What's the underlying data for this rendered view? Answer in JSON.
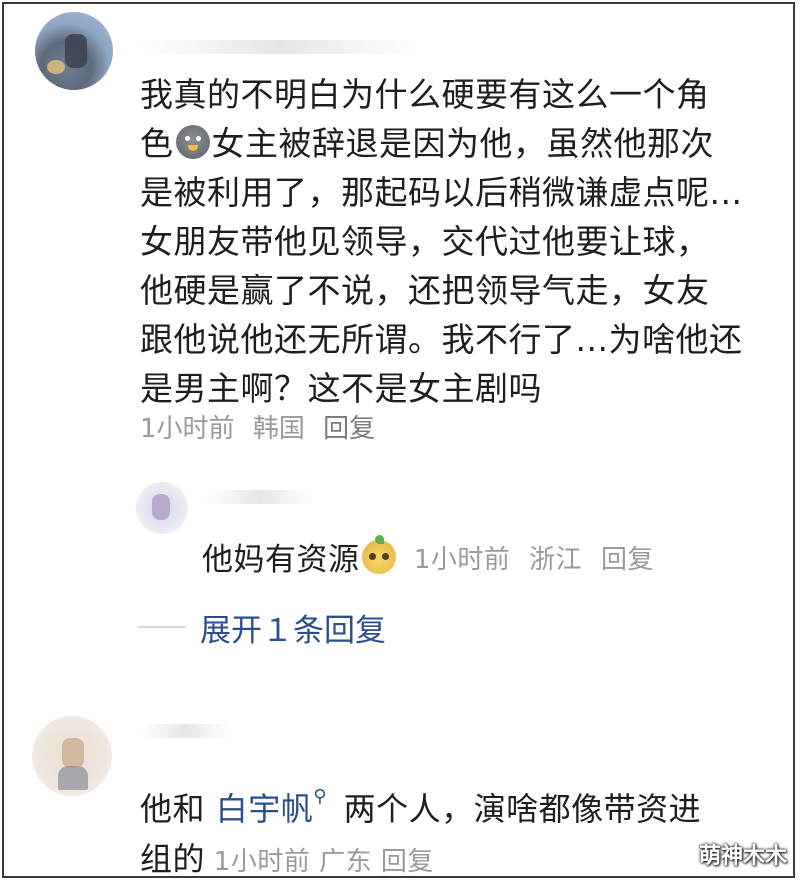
{
  "comments": [
    {
      "lines": [
        "我真的不明白为什么硬要有这么一个角",
        "女主被辞退是因为他，虽然他那次",
        "是被利用了，那起码以后稍微谦虚点呢...",
        "女朋友带他见领导，交代过他要让球，",
        "他硬是赢了不说，还把领导气走，女友",
        "跟他说他还无所谓。我不行了...为啥他还",
        "是男主啊？这不是女主剧吗"
      ],
      "line2_prefix": "色",
      "line2_emoji": "grey-face-emoji",
      "time": "1小时前",
      "location": "韩国",
      "reply_label": "回复"
    },
    {
      "text": "他妈有资源",
      "emoji": "yellow-face-emoji",
      "time": "1小时前",
      "location": "浙江",
      "reply_label": "回复"
    }
  ],
  "expand_label": "展开１条回复",
  "comment3": {
    "before_mention": "他和 ",
    "mention": "白宇帆",
    "mention_icon": "search-icon",
    "after_mention": " 两个人，演啥都像带资进",
    "line2": "组的",
    "time": "1小时前",
    "location": "广东",
    "reply_label": "回复"
  },
  "watermark": "萌神木木"
}
